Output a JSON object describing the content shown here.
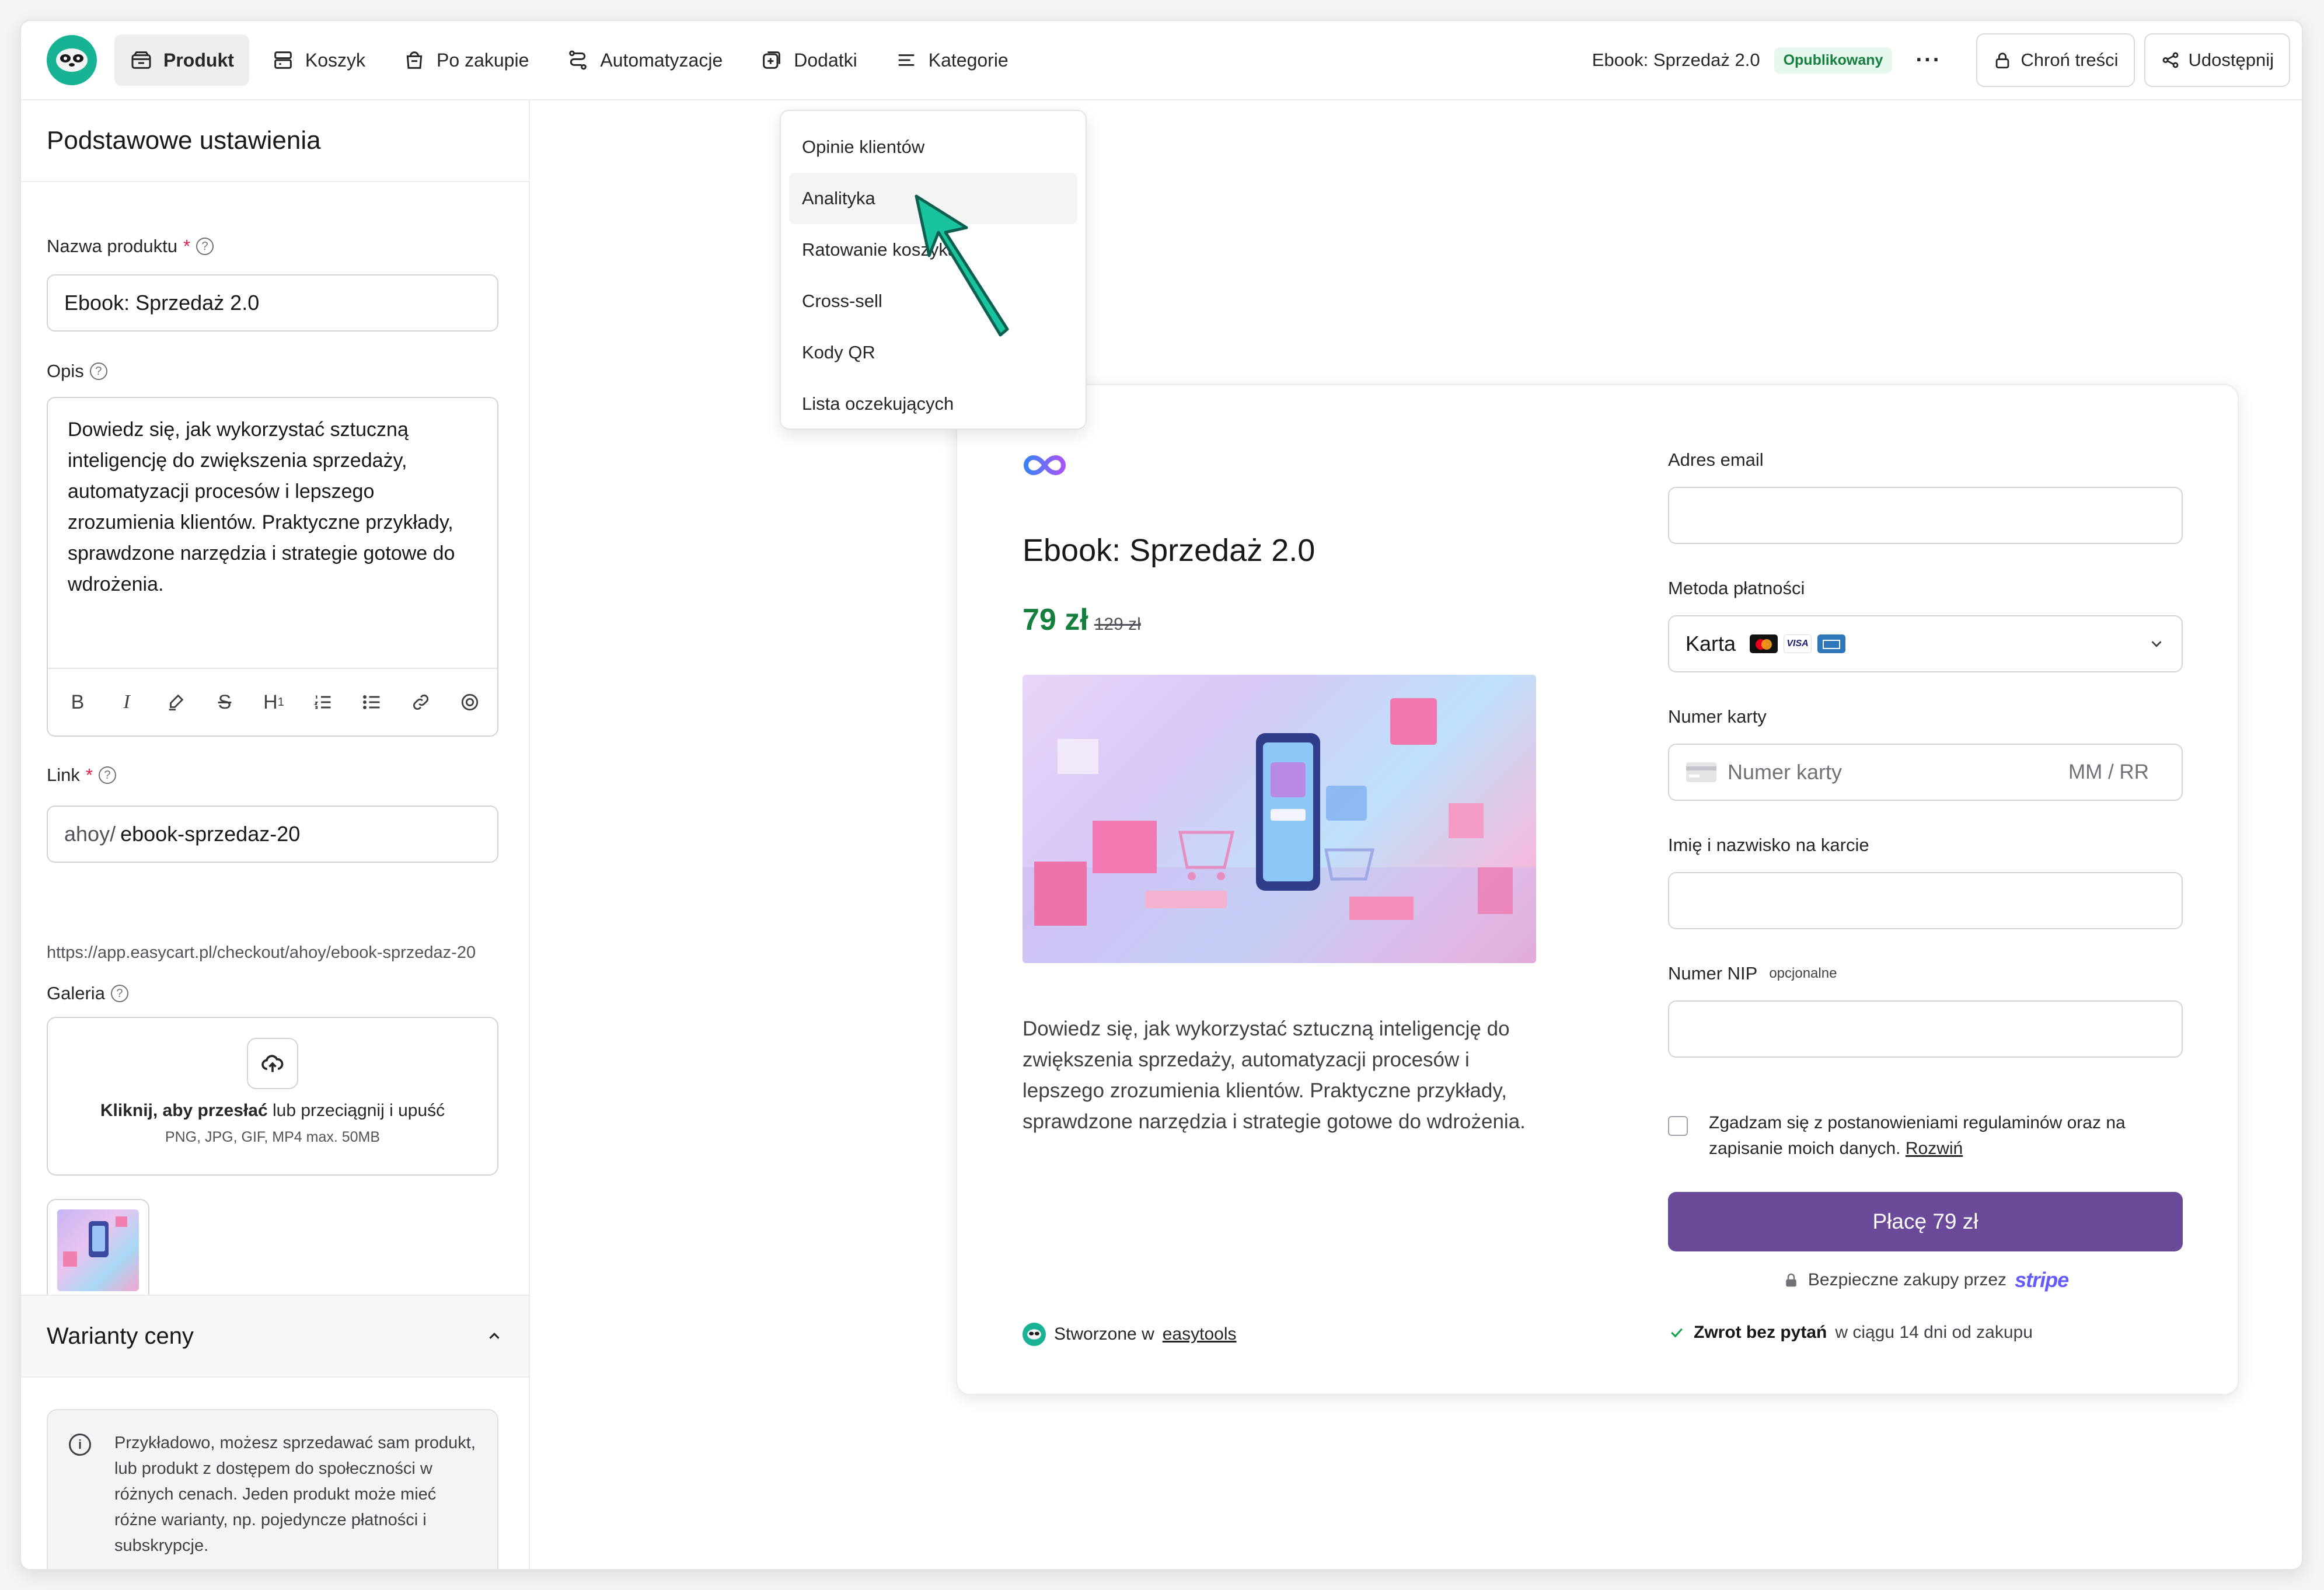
{
  "nav": {
    "items": [
      {
        "label": "Produkt",
        "icon": "box-icon",
        "active": true
      },
      {
        "label": "Koszyk",
        "icon": "cart-icon",
        "active": false
      },
      {
        "label": "Po zakupie",
        "icon": "package-icon",
        "active": false
      },
      {
        "label": "Automatyzacje",
        "icon": "route-icon",
        "active": false
      },
      {
        "label": "Dodatki",
        "icon": "plus-square-icon",
        "active": false
      },
      {
        "label": "Kategorie",
        "icon": "menu-lines-icon",
        "active": false
      }
    ],
    "product_name": "Ebook: Sprzedaż 2.0",
    "status": "Opublikowany",
    "more": "···",
    "protect_label": "Chroń treści",
    "share_label": "Udostępnij"
  },
  "dropdown": {
    "items": [
      "Opinie klientów",
      "Analityka",
      "Ratowanie koszyka",
      "Cross-sell",
      "Kody QR",
      "Lista oczekujących"
    ],
    "hovered": "Analityka"
  },
  "sidebar": {
    "title": "Podstawowe ustawienia",
    "name_label": "Nazwa produktu",
    "name_value": "Ebook: Sprzedaż 2.0",
    "desc_label": "Opis",
    "desc_value": "Dowiedz się, jak wykorzystać sztuczną inteligencję do zwiększenia sprzedaży, automatyzacji procesów i lepszego zrozumienia klientów. Praktyczne przykłady, sprawdzone narzędzia i strategie gotowe do wdrożenia.",
    "link_label": "Link",
    "link_prefix": "ahoy/",
    "link_value": "ebook-sprzedaz-20",
    "link_url": "https://app.easycart.pl/checkout/ahoy/ebook-sprzedaz-20",
    "gallery_label": "Galeria",
    "upload_bold": "Kliknij, aby przesłać",
    "upload_rest": "lub przeciągnij i upuść",
    "upload_formats": "PNG, JPG, GIF, MP4 max. 50MB",
    "variants_title": "Warianty ceny",
    "variants_info": "Przykładowo, możesz sprzedawać sam produkt, lub produkt z dostępem do społeczności w różnych cenach. Jeden produkt może mieć różne warianty, np. pojedyncze płatności i subskrypcje."
  },
  "checkout": {
    "title": "Ebook: Sprzedaż 2.0",
    "price": "79 zł",
    "old_price": "129 zł",
    "description": "Dowiedz się, jak wykorzystać sztuczną inteligencję do zwiększenia sprzedaży, automatyzacji procesów i lepszego zrozumienia klientów. Praktyczne przykłady, sprawdzone narzędzia i strategie gotowe do wdrożenia.",
    "email_label": "Adres email",
    "payment_label": "Metoda płatności",
    "payment_value": "Karta",
    "card_label": "Numer karty",
    "card_placeholder": "Numer karty",
    "expiry_placeholder": "MM / RR",
    "holder_label": "Imię i nazwisko na karcie",
    "nip_label": "Numer NIP",
    "nip_optional": "opcjonalne",
    "consent_text": "Zgadzam się z postanowieniami regulaminów oraz na zapisanie moich danych.",
    "consent_link": "Rozwiń",
    "pay_button": "Płacę 79 zł",
    "secure_text": "Bezpieczne zakupy przez",
    "secure_brand": "stripe",
    "made_with": "Stworzone w",
    "made_with_link": "easytools",
    "refund_bold": "Zwrot bez pytań",
    "refund_rest": "w ciągu 14 dni od zakupu"
  },
  "colors": {
    "brand_green": "#17b394",
    "price_green": "#15803d",
    "pay_button": "#6b4a9a",
    "arrow": "#19c39e",
    "stripe": "#635bff"
  }
}
